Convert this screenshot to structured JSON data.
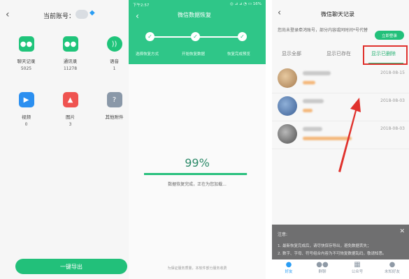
{
  "left": {
    "title": "当前账号：",
    "items": [
      {
        "label": "聊天记录",
        "count": "5025",
        "icon": "chat-icon",
        "color": "#1fc47a"
      },
      {
        "label": "通讯录",
        "count": "11278",
        "icon": "contacts-icon",
        "color": "#1fc47a"
      },
      {
        "label": "语音",
        "count": "1",
        "icon": "voice-icon",
        "color": "#1fc47a"
      },
      {
        "label": "视频",
        "count": "0",
        "icon": "video-icon",
        "color": "#2b8ff0"
      },
      {
        "label": "图片",
        "count": "3",
        "icon": "image-icon",
        "color": "#ef5350"
      },
      {
        "label": "其他附件",
        "count": "",
        "icon": "file-icon",
        "color": "#8a98a8"
      }
    ],
    "export_label": "一键导出"
  },
  "middle": {
    "status_time": "下午2:57",
    "status_right": "◎ ⊿ ⊿ ◔ ▭ 16%",
    "title": "微信数据恢复",
    "steps": [
      "选择恢复方式",
      "开始恢复数据",
      "恢复完成预览"
    ],
    "percent": "99%",
    "progress": 0.99,
    "progress_text": "数据恢复完成，正在为您加载...",
    "footer": "为保证服务质量，本软件部分服务收费"
  },
  "right": {
    "title": "微信聊天记录",
    "notice": "您尚未登录牵鸿账号，部分内容或同时间*号代替",
    "login_label": "立即登录",
    "tabs": [
      "显示全部",
      "显示已存在",
      "显示已删除"
    ],
    "rows": [
      {
        "date": "2018-08-15",
        "avatar_color": "#c9a57a"
      },
      {
        "date": "2018-08-03",
        "avatar_color": "#4a6fa5"
      },
      {
        "date": "2018-08-03",
        "avatar_color": "#6b6b6b"
      }
    ],
    "notice_sheet": {
      "title": "注意:",
      "lines": [
        "1. 最新恢复完成后，请尽快保存导出，避免数据丢失；",
        "2. 数字、字母、符号组合内容为不可恢复数据乱码，敬请知悉。"
      ]
    },
    "nav": [
      {
        "label": "好友",
        "icon": "person-icon"
      },
      {
        "label": "群聊",
        "icon": "group-icon"
      },
      {
        "label": "公众号",
        "icon": "grid-icon"
      },
      {
        "label": "未知好友",
        "icon": "unknown-person-icon"
      }
    ]
  },
  "colors": {
    "accent": "#22c07a",
    "highlight": "#e0322d",
    "nav_active": "#2a9df4"
  }
}
